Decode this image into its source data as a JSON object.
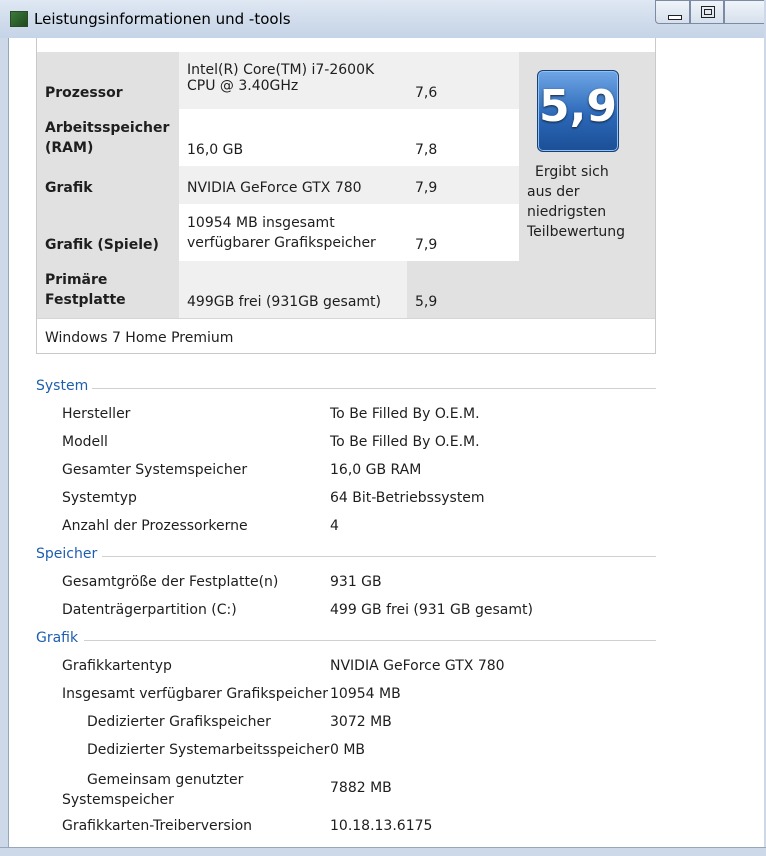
{
  "window": {
    "title": "Leistungsinformationen und -tools"
  },
  "rating": {
    "rows": [
      {
        "label": "Prozessor",
        "value": "Intel(R) Core(TM) i7-2600K CPU @ 3.40GHz",
        "score": "7,6"
      },
      {
        "label": "Arbeitsspeicher (RAM)",
        "value": "16,0 GB",
        "score": "7,8"
      },
      {
        "label": "Grafik",
        "value": "NVIDIA GeForce GTX 780",
        "score": "7,9"
      },
      {
        "label": "Grafik (Spiele)",
        "value": "10954 MB insgesamt verfügbarer Grafikspeicher",
        "score": "7,9"
      },
      {
        "label": "Primäre Festplatte",
        "value": "499GB frei (931GB gesamt)",
        "score": "5,9"
      }
    ],
    "base_score": "5,9",
    "base_desc_1": "Ergibt sich",
    "base_desc_2": "aus der",
    "base_desc_3": "niedrigsten",
    "base_desc_4": "Teilbewertung",
    "edition": "Windows 7 Home Premium"
  },
  "system": {
    "heading": "System",
    "items": [
      {
        "key": "Hersteller",
        "value": "To Be Filled By O.E.M."
      },
      {
        "key": "Modell",
        "value": "To Be Filled By O.E.M."
      },
      {
        "key": "Gesamter Systemspeicher",
        "value": "16,0 GB RAM"
      },
      {
        "key": "Systemtyp",
        "value": "64 Bit-Betriebssystem"
      },
      {
        "key": "Anzahl der Prozessorkerne",
        "value": "4"
      }
    ]
  },
  "storage": {
    "heading": "Speicher",
    "items": [
      {
        "key": "Gesamtgröße der Festplatte(n)",
        "value": "931 GB"
      },
      {
        "key": "Datenträgerpartition (C:)",
        "value": "499 GB frei (931 GB gesamt)"
      }
    ]
  },
  "graphics": {
    "heading": "Grafik",
    "items": [
      {
        "key": "Grafikkartentyp",
        "value": "NVIDIA GeForce GTX 780"
      },
      {
        "key": "Insgesamt verfügbarer Grafikspeicher",
        "value": "10954 MB"
      },
      {
        "key": "Dedizierter Grafikspeicher",
        "value": "3072 MB"
      },
      {
        "key": "Dedizierter Systemarbeitsspeicher",
        "value": "0 MB"
      },
      {
        "key": "Gemeinsam genutzter Systemspeicher",
        "value": "7882 MB"
      },
      {
        "key": "Grafikkarten-Treiberversion",
        "value": "10.18.13.6175"
      }
    ]
  }
}
